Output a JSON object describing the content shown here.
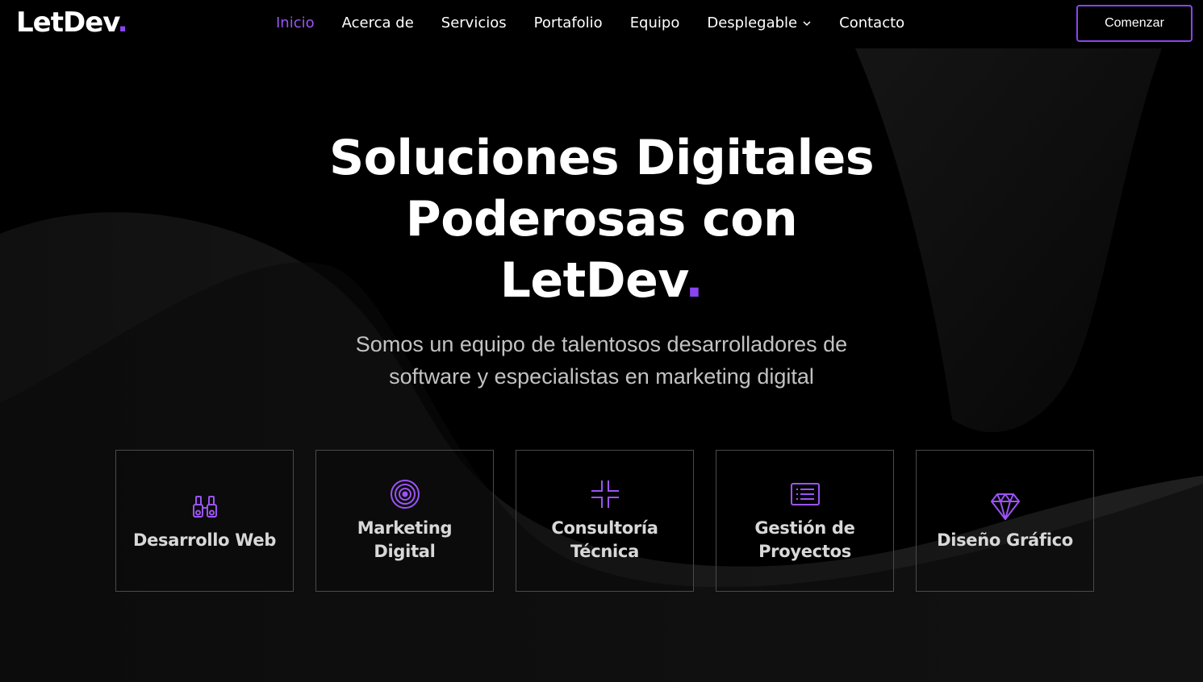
{
  "brand": {
    "name": "LetDev",
    "dot": ".",
    "accent": "#8a44f0"
  },
  "nav": {
    "items": [
      {
        "label": "Inicio",
        "active": true
      },
      {
        "label": "Acerca de"
      },
      {
        "label": "Servicios"
      },
      {
        "label": "Portafolio"
      },
      {
        "label": "Equipo"
      },
      {
        "label": "Desplegable",
        "icon": "chevron-down-icon"
      },
      {
        "label": "Contacto"
      }
    ],
    "cta_label": "Comenzar"
  },
  "hero": {
    "title_line1": "Soluciones Digitales",
    "title_line2": "Poderosas con",
    "title_brand": "LetDev",
    "title_dot": ".",
    "subtitle": "Somos un equipo de talentosos desarrolladores de software y especialistas en marketing digital"
  },
  "services": [
    {
      "label": "Desarrollo Web",
      "icon": "binoculars-icon"
    },
    {
      "label": "Marketing Digital",
      "icon": "target-icon"
    },
    {
      "label": "Consultoría Técnica",
      "icon": "collapse-corners-icon"
    },
    {
      "label": "Gestión de Proyectos",
      "icon": "list-icon"
    },
    {
      "label": "Diseño Gráfico",
      "icon": "diamond-icon"
    }
  ]
}
